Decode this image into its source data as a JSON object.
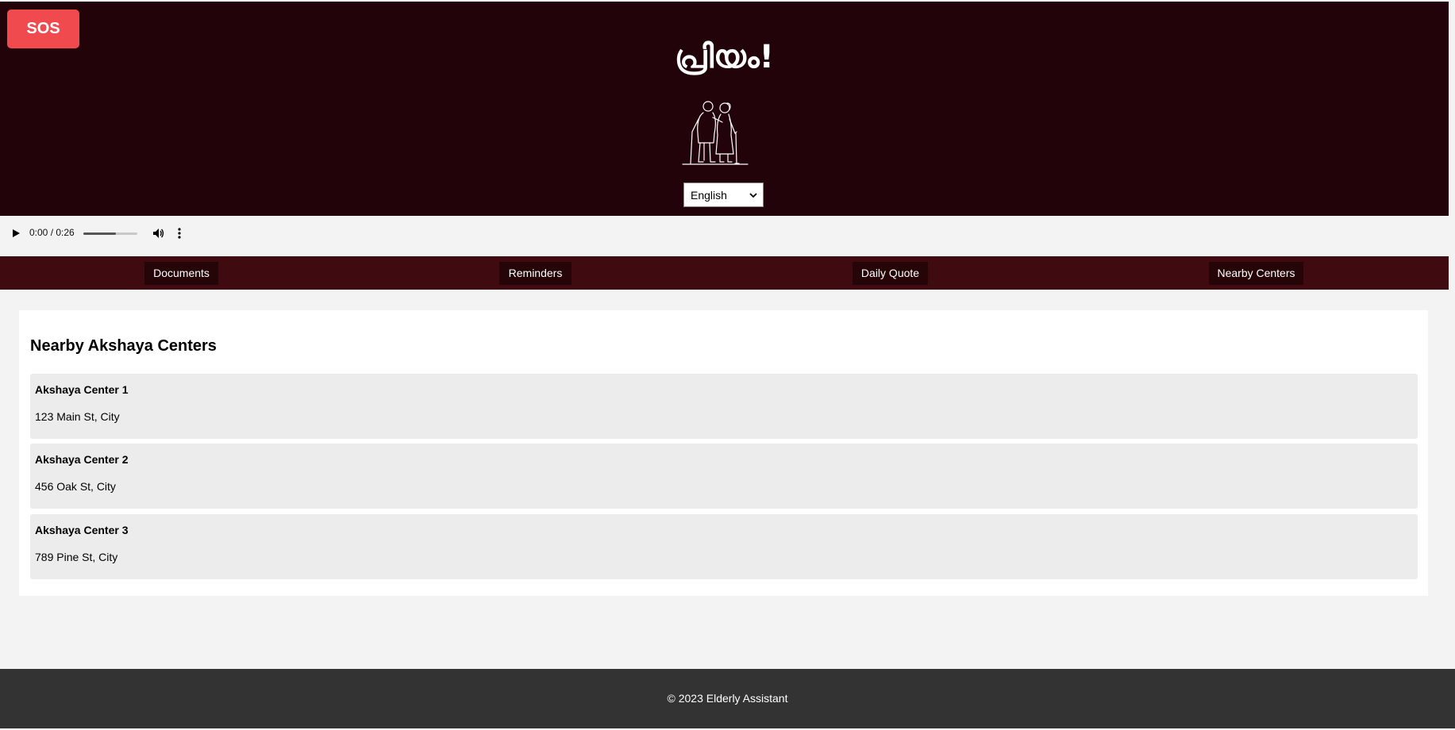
{
  "header": {
    "sos_label": "SOS",
    "title": "പ്രിയം!",
    "language_selected": "English"
  },
  "audio": {
    "time": "0:00 / 0:26",
    "volume_level": 0.6
  },
  "nav": {
    "tabs": [
      {
        "label": "Documents"
      },
      {
        "label": "Reminders"
      },
      {
        "label": "Daily Quote"
      },
      {
        "label": "Nearby Centers"
      }
    ]
  },
  "main": {
    "heading": "Nearby Akshaya Centers",
    "centers": [
      {
        "name": "Akshaya Center 1",
        "address": "123 Main St, City"
      },
      {
        "name": "Akshaya Center 2",
        "address": "456 Oak St, City"
      },
      {
        "name": "Akshaya Center 3",
        "address": "789 Pine St, City"
      }
    ]
  },
  "footer": {
    "text": "© 2023 Elderly Assistant"
  },
  "colors": {
    "header_bg": "#22030a",
    "sos": "#f04a4f",
    "nav_bg": "#3f0b10",
    "tab_bg": "#250508",
    "footer_bg": "#333333"
  }
}
